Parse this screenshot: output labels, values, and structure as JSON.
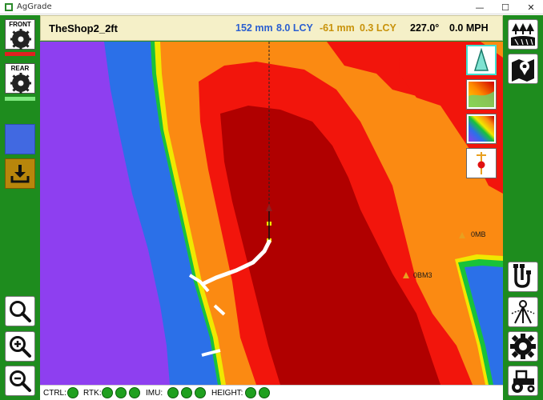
{
  "window": {
    "title": "AgGrade",
    "minimize": "—",
    "maximize": "☐",
    "close": "✕"
  },
  "header": {
    "field_name": "TheShop2_2ft",
    "front_cut": "152 mm",
    "front_volume": "8.0 LCY",
    "rear_fill": "-61 mm",
    "rear_volume": "0.3 LCY",
    "heading": "227.0°",
    "speed": "0.0 MPH",
    "front_color": "#2b5fd0",
    "rear_color": "#c8920a"
  },
  "left_toolbar": {
    "front_blade": {
      "label": "FRONT",
      "icon": "front-blade-gear-icon",
      "status_color": "#e02020"
    },
    "rear_blade": {
      "label": "REAR",
      "icon": "rear-blade-gear-icon",
      "status_color": "#7ee87e"
    },
    "blade_mode_color": "#4169e1",
    "download_icon": "download-tray-icon",
    "zoom_fit_icon": "magnifier-icon",
    "zoom_in_icon": "zoom-in-icon",
    "zoom_out_icon": "zoom-out-icon"
  },
  "right_toolbar": {
    "top": [
      "field-trees-icon",
      "map-pin-icon"
    ],
    "bottom": [
      "hydraulic-hose-icon",
      "survey-tripod-icon",
      "gear-icon",
      "tractor-icon"
    ]
  },
  "map_overlay_buttons": [
    "north-arrow-icon",
    "terrain-gradient-icon",
    "cut-fill-gradient-icon",
    "benchmark-pin-icon"
  ],
  "map_labels": {
    "benchmark_1": "0MB",
    "benchmark_2": "0BM3"
  },
  "status": {
    "ctrl": {
      "label": "CTRL:",
      "lights": 1
    },
    "rtk": {
      "label": "RTK:",
      "lights": 3
    },
    "imu": {
      "label": "IMU:",
      "lights": 3
    },
    "height": {
      "label": "HEIGHT:",
      "lights": 2
    }
  }
}
